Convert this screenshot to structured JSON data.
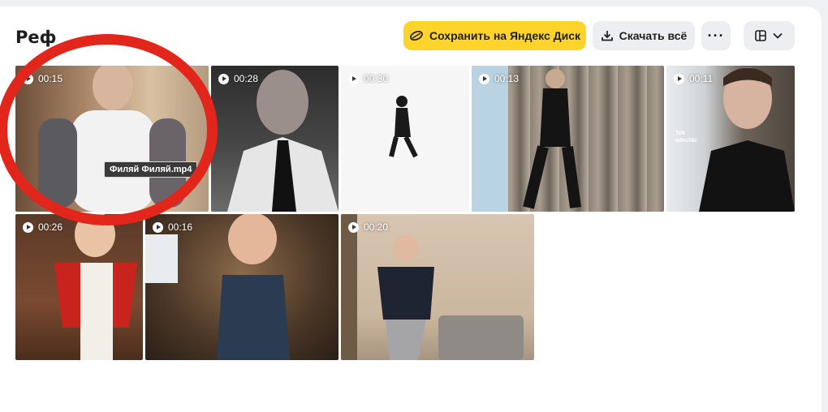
{
  "header": {
    "title": "Реф",
    "save_label": "Сохранить на Яндекс Диск",
    "download_label": "Скачать всё",
    "more_label": "···"
  },
  "colors": {
    "save_button": "#fed42b",
    "secondary_button": "#edeef1",
    "highlight_ring": "#e3261c"
  },
  "videos": [
    {
      "duration": "00:15",
      "filename": "Филяй Филяй.mp4"
    },
    {
      "duration": "00:28"
    },
    {
      "duration": "00:30"
    },
    {
      "duration": "00:13"
    },
    {
      "duration": "00:11"
    },
    {
      "duration": "00:26"
    },
    {
      "duration": "00:16"
    },
    {
      "duration": "00:20"
    }
  ],
  "overlay_text": {
    "tiktok_line1": "Tok",
    "tiktok_line2": "adechki"
  },
  "icons": {
    "save": "disk-icon",
    "download": "download-icon",
    "more": "more-icon",
    "view": "grid-view-icon",
    "dropdown": "chevron-down-icon",
    "play": "play-icon"
  }
}
